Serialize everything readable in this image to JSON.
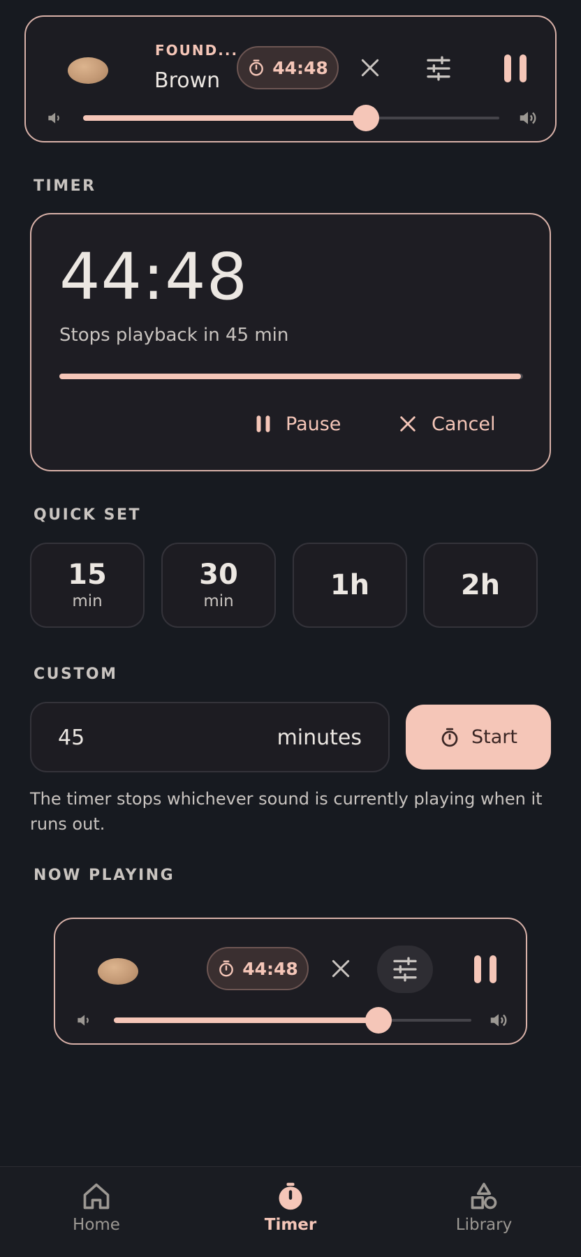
{
  "top_player": {
    "category": "FOUND...",
    "sound_name": "Brown",
    "timer_pill": "44:48",
    "volume_fraction": 0.68
  },
  "timer_section": {
    "label": "TIMER",
    "time_remaining": "44:48",
    "stops_text": "Stops playback in 45 min",
    "progress_fraction": 0.995,
    "pause_label": "Pause",
    "cancel_label": "Cancel"
  },
  "quick_set": {
    "label": "QUICK SET",
    "options": [
      {
        "num": "15",
        "unit": "min"
      },
      {
        "num": "30",
        "unit": "min"
      },
      {
        "num": "1h",
        "unit": ""
      },
      {
        "num": "2h",
        "unit": ""
      }
    ]
  },
  "custom": {
    "label": "CUSTOM",
    "value": "45",
    "unit": "minutes",
    "start_label": "Start",
    "helper": "The timer stops whichever sound is currently playing when it runs out."
  },
  "now_playing": {
    "label": "NOW PLAYING",
    "timer_pill": "44:48",
    "volume_fraction": 0.74
  },
  "nav": {
    "home": "Home",
    "timer": "Timer",
    "library": "Library"
  },
  "colors": {
    "accent": "#f5c6b8",
    "background": "#171a20"
  },
  "icons": [
    "pebble-image",
    "timer-icon",
    "close-icon",
    "tune-icon",
    "pause-icon",
    "volume-low-icon",
    "volume-high-icon",
    "home-icon",
    "library-icon"
  ]
}
